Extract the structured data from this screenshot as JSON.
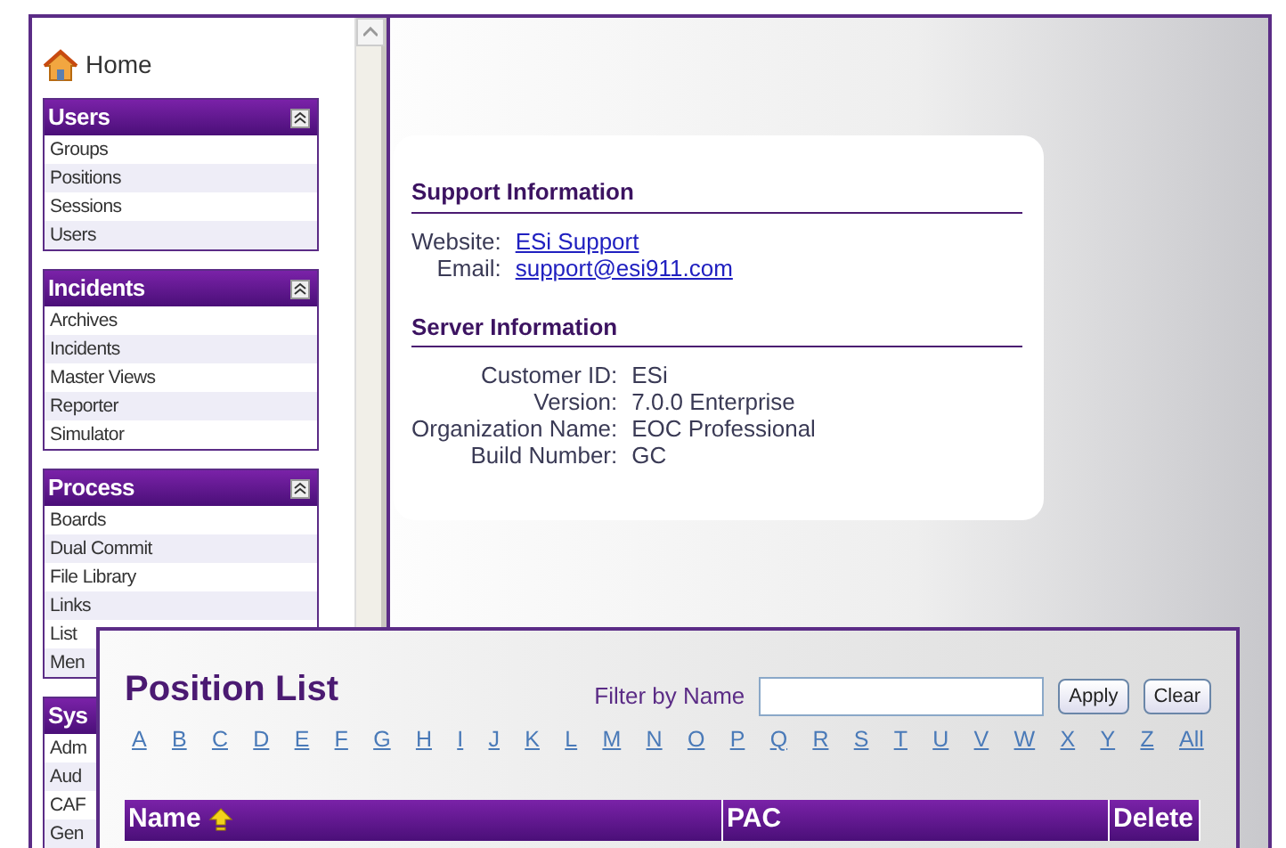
{
  "home": {
    "label": "Home"
  },
  "sidebar": {
    "panels": [
      {
        "title": "Users",
        "items": [
          "Groups",
          "Positions",
          "Sessions",
          "Users"
        ]
      },
      {
        "title": "Incidents",
        "items": [
          "Archives",
          "Incidents",
          "Master Views",
          "Reporter",
          "Simulator"
        ]
      },
      {
        "title": "Process",
        "items": [
          "Boards",
          "Dual Commit",
          "File Library",
          "Links",
          "List",
          "Men"
        ]
      },
      {
        "title": "Sys",
        "items": [
          "Adm",
          "Aud",
          "CAF",
          "Gen"
        ]
      }
    ]
  },
  "support": {
    "title": "Support Information",
    "rows": [
      {
        "label": "Website:",
        "value": "ESi Support",
        "kind": "link"
      },
      {
        "label": "Email:",
        "value": "support@esi911.com",
        "kind": "link"
      }
    ]
  },
  "server": {
    "title": "Server Information",
    "rows": [
      {
        "label": "Customer ID:",
        "value": "ESi",
        "kind": "text"
      },
      {
        "label": "Version:",
        "value": "7.0.0 Enterprise",
        "kind": "text"
      },
      {
        "label": "Organization Name:",
        "value": "EOC Professional",
        "kind": "text"
      },
      {
        "label": "Build Number:",
        "value": "GC",
        "kind": "text"
      }
    ]
  },
  "position_list": {
    "title": "Position List",
    "filter_label": "Filter by Name",
    "buttons": [
      "Apply",
      "Clear"
    ],
    "letters": [
      "A",
      "B",
      "C",
      "D",
      "E",
      "F",
      "G",
      "H",
      "I",
      "J",
      "K",
      "L",
      "M",
      "N",
      "O",
      "P",
      "Q",
      "R",
      "S",
      "T",
      "U",
      "V",
      "W",
      "X",
      "Y",
      "Z",
      "All"
    ],
    "columns": [
      {
        "label": "Name",
        "sorted": true
      },
      {
        "label": "PAC",
        "sorted": false
      },
      {
        "label": "Delete",
        "sorted": false
      }
    ]
  }
}
